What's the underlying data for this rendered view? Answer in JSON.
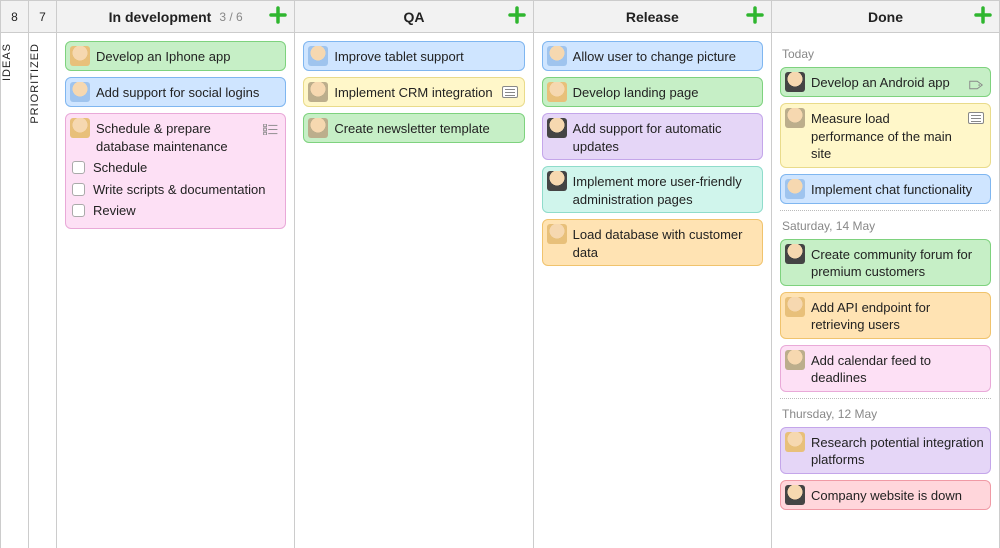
{
  "lanes": {
    "ideas": {
      "count": "8",
      "label": "IDEAS"
    },
    "prioritized": {
      "count": "7",
      "label": "PRIORITIZED"
    },
    "indev": {
      "title": "In development",
      "wip": "3 / 6"
    },
    "qa": {
      "title": "QA"
    },
    "release": {
      "title": "Release"
    },
    "done": {
      "title": "Done"
    }
  },
  "indev": [
    {
      "color": "green",
      "avatar": "av1",
      "title": "Develop an Iphone app"
    },
    {
      "color": "blue",
      "avatar": "av2",
      "title": "Add support for social logins"
    },
    {
      "color": "pink",
      "avatar": "av1",
      "title": "Schedule & prepare database maintenance",
      "checklist_badge": true,
      "subs": [
        {
          "label": "Schedule"
        },
        {
          "label": "Write scripts & documentation"
        },
        {
          "label": "Review"
        }
      ]
    }
  ],
  "qa": [
    {
      "color": "blue",
      "avatar": "av2",
      "title": "Improve tablet support"
    },
    {
      "color": "yellow",
      "avatar": "av4",
      "title": "Implement CRM integration",
      "note_badge": true
    },
    {
      "color": "green",
      "avatar": "av4",
      "title": "Create newsletter template"
    }
  ],
  "release": [
    {
      "color": "blue",
      "avatar": "av2",
      "title": "Allow user to change picture"
    },
    {
      "color": "green",
      "avatar": "av1",
      "title": "Develop landing page"
    },
    {
      "color": "purple",
      "avatar": "av3",
      "title": "Add support for automatic updates"
    },
    {
      "color": "teal",
      "avatar": "av3",
      "title": "Implement more user-friendly administration pages"
    },
    {
      "color": "orange",
      "avatar": "av1",
      "title": "Load database with customer data"
    }
  ],
  "done_groups": [
    {
      "date": "Today",
      "cards": [
        {
          "color": "green",
          "avatar": "av3",
          "title": "Develop an Android app",
          "tag_badge": true
        },
        {
          "color": "yellow",
          "avatar": "av4",
          "title": "Measure load performance of the main site",
          "note_badge": true
        },
        {
          "color": "blue",
          "avatar": "av2",
          "title": "Implement chat functionality"
        }
      ]
    },
    {
      "date": "Saturday, 14 May",
      "cards": [
        {
          "color": "green",
          "avatar": "av3",
          "title": "Create community forum for premium customers"
        },
        {
          "color": "orange",
          "avatar": "av1",
          "title": "Add API endpoint for retrieving users"
        },
        {
          "color": "pink",
          "avatar": "av4",
          "title": "Add calendar feed to deadlines"
        }
      ]
    },
    {
      "date": "Thursday, 12 May",
      "cards": [
        {
          "color": "purple",
          "avatar": "av1",
          "title": "Research potential integration platforms"
        },
        {
          "color": "rose",
          "avatar": "av3",
          "title": "Company website is down"
        }
      ]
    }
  ]
}
